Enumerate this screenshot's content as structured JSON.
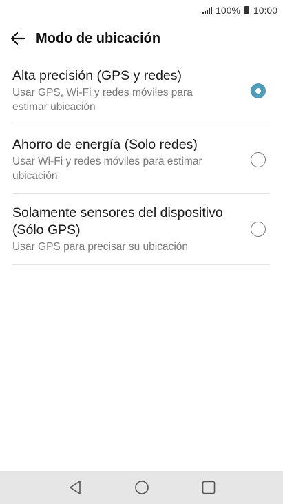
{
  "status_bar": {
    "battery_percent": "100%",
    "time": "10:00",
    "icons": [
      "signal-icon",
      "battery-icon"
    ]
  },
  "header": {
    "title": "Modo de ubicación",
    "back_icon": "back-arrow-icon"
  },
  "options": [
    {
      "title": "Alta precisión (GPS y redes)",
      "subtitle": "Usar GPS, Wi-Fi y redes móviles para estimar ubicación",
      "selected": true
    },
    {
      "title": "Ahorro de energía (Solo redes)",
      "subtitle": "Usar Wi-Fi y redes móviles para estimar ubicación",
      "selected": false
    },
    {
      "title": "Solamente sensores del dispositivo (Sólo GPS)",
      "subtitle": "Usar GPS para precisar su ubicación",
      "selected": false
    }
  ],
  "nav_bar": {
    "icons": [
      "back-triangle-icon",
      "home-circle-icon",
      "recents-square-icon"
    ]
  },
  "colors": {
    "accent": "#4e9cb8",
    "nav_background": "#e6e6e6",
    "divider": "#e4e4e4"
  }
}
